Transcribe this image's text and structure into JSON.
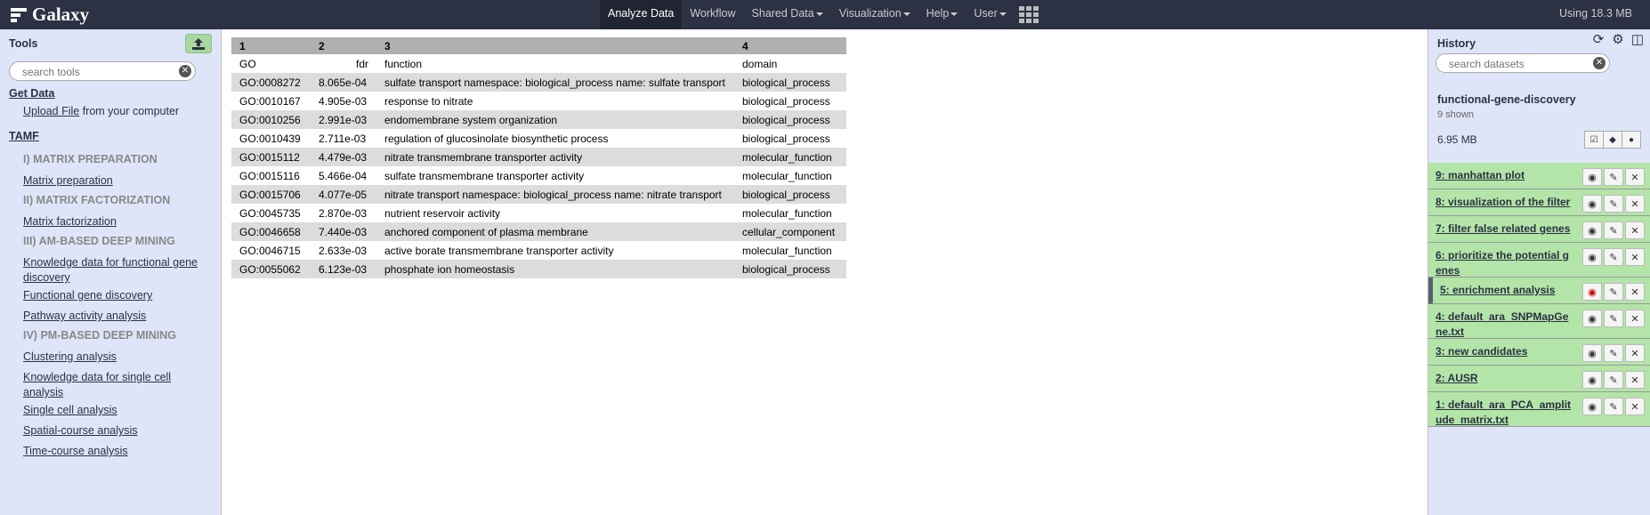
{
  "masthead": {
    "brand": "Galaxy",
    "nav": [
      {
        "label": "Analyze Data",
        "active": true,
        "caret": false
      },
      {
        "label": "Workflow",
        "active": false,
        "caret": false
      },
      {
        "label": "Shared Data",
        "active": false,
        "caret": true
      },
      {
        "label": "Visualization",
        "active": false,
        "caret": true
      },
      {
        "label": "Help",
        "active": false,
        "caret": true
      },
      {
        "label": "User",
        "active": false,
        "caret": true
      }
    ],
    "quota": "Using 18.3 MB"
  },
  "tools": {
    "title": "Tools",
    "search_placeholder": "search tools",
    "get_data": "Get Data",
    "upload_link": "Upload File",
    "upload_rest": " from your computer",
    "tamf": "TAMF",
    "items": [
      {
        "kind": "label",
        "text": "I) MATRIX PREPARATION"
      },
      {
        "kind": "link",
        "text": "Matrix preparation"
      },
      {
        "kind": "label",
        "text": "II) MATRIX FACTORIZATION"
      },
      {
        "kind": "link",
        "text": "Matrix factorization"
      },
      {
        "kind": "label",
        "text": "III) AM-BASED DEEP MINING"
      },
      {
        "kind": "link",
        "text": "Knowledge data for functional gene discovery"
      },
      {
        "kind": "link",
        "text": "Functional gene discovery"
      },
      {
        "kind": "link",
        "text": "Pathway activity analysis"
      },
      {
        "kind": "label",
        "text": "IV) PM-BASED DEEP MINING"
      },
      {
        "kind": "link",
        "text": "Clustering analysis"
      },
      {
        "kind": "link",
        "text": "Knowledge data for single cell analysis"
      },
      {
        "kind": "link",
        "text": "Single cell analysis"
      },
      {
        "kind": "link",
        "text": "Spatial-course analysis"
      },
      {
        "kind": "link",
        "text": "Time-course analysis"
      }
    ]
  },
  "table": {
    "col_numbers": [
      "1",
      "2",
      "3",
      "4"
    ],
    "headers": [
      "GO",
      "fdr",
      "function",
      "domain"
    ],
    "rows": [
      [
        "GO:0008272",
        "8.065e-04",
        "sulfate transport namespace: biological_process name: sulfate transport",
        "biological_process"
      ],
      [
        "GO:0010167",
        "4.905e-03",
        "response to nitrate",
        "biological_process"
      ],
      [
        "GO:0010256",
        "2.991e-03",
        "endomembrane system organization",
        "biological_process"
      ],
      [
        "GO:0010439",
        "2.711e-03",
        "regulation of glucosinolate biosynthetic process",
        "biological_process"
      ],
      [
        "GO:0015112",
        "4.479e-03",
        "nitrate transmembrane transporter activity",
        "molecular_function"
      ],
      [
        "GO:0015116",
        "5.466e-04",
        "sulfate transmembrane transporter activity",
        "molecular_function"
      ],
      [
        "GO:0015706",
        "4.077e-05",
        "nitrate transport namespace: biological_process name: nitrate transport",
        "biological_process"
      ],
      [
        "GO:0045735",
        "2.870e-03",
        "nutrient reservoir activity",
        "molecular_function"
      ],
      [
        "GO:0046658",
        "7.440e-03",
        "anchored component of plasma membrane",
        "cellular_component"
      ],
      [
        "GO:0046715",
        "2.633e-03",
        "active borate transmembrane transporter activity",
        "molecular_function"
      ],
      [
        "GO:0055062",
        "6.123e-03",
        "phosphate ion homeostasis",
        "biological_process"
      ]
    ]
  },
  "history": {
    "title": "History",
    "search_placeholder": "search datasets",
    "name": "functional-gene-discovery",
    "shown": "9 shown",
    "size": "6.95 MB",
    "datasets": [
      {
        "title": "9: manhattan plot",
        "selected": false
      },
      {
        "title": "8: visualization of the filter",
        "selected": false
      },
      {
        "title": "7: filter false related genes",
        "selected": false
      },
      {
        "title": "6: prioritize the potential genes",
        "selected": false
      },
      {
        "title": "5: enrichment analysis",
        "selected": true
      },
      {
        "title": "4: default_ara_SNPMapGene.txt",
        "selected": false
      },
      {
        "title": "3: new candidates",
        "selected": false
      },
      {
        "title": "2: AUSR",
        "selected": false
      },
      {
        "title": "1: default_ara_PCA_amplitude_matrix.txt",
        "selected": false
      }
    ]
  },
  "colors": {
    "masthead": "#2c3143",
    "panel": "#dfe5f9",
    "dataset_ok": "#b3e5a8",
    "table_header": "#b0b0b0",
    "table_alt": "#dcdcdc"
  }
}
